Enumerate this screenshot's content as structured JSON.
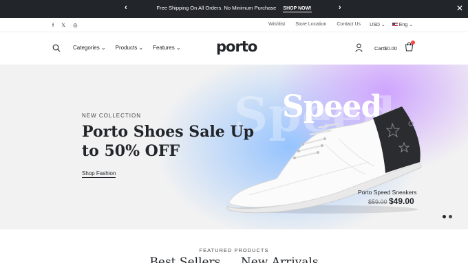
{
  "announcement": {
    "message": "Free Shipping On All Orders. No Minimum Purchase",
    "cta": "SHOP NOW!",
    "prev_icon": "chevron-left-icon",
    "next_icon": "chevron-right-icon",
    "close_icon": "close-icon"
  },
  "utility": {
    "social": [
      {
        "icon": "facebook-icon",
        "glyph": "f"
      },
      {
        "icon": "x-icon",
        "glyph": "𝕏"
      },
      {
        "icon": "instagram-icon",
        "glyph": "◎"
      }
    ],
    "links": [
      "Wishlist",
      "Store Location",
      "Contact Us"
    ],
    "currency": "USD ⌄",
    "language": "Eng ⌄"
  },
  "header": {
    "nav": [
      "Categories ⌄",
      "Products ⌄",
      "Features ⌄"
    ],
    "logo": "porto",
    "cart_label": "Cart",
    "cart_total": "$0.00"
  },
  "hero": {
    "eyebrow": "NEW COLLECTION",
    "headline": "Porto Shoes Sale Up to 50% OFF",
    "cta": "Shop Fashion",
    "backdrop_word": "Speed",
    "word": "Speed",
    "product_name": "Porto Speed Sneakers",
    "old_price": "$59.00",
    "new_price": "$49.00",
    "slide_count": 2,
    "active_slide": 1
  },
  "featured": {
    "eyebrow": "FEATURED PRODUCTS",
    "tabs": [
      "Best Sellers",
      "New Arrivals"
    ]
  },
  "colors": {
    "dark": "#222529",
    "badge": "#ff4242",
    "hero_bg": "#f2f2f2",
    "hero_blue": "#8cbeff",
    "hero_purple": "#cca0ff"
  }
}
